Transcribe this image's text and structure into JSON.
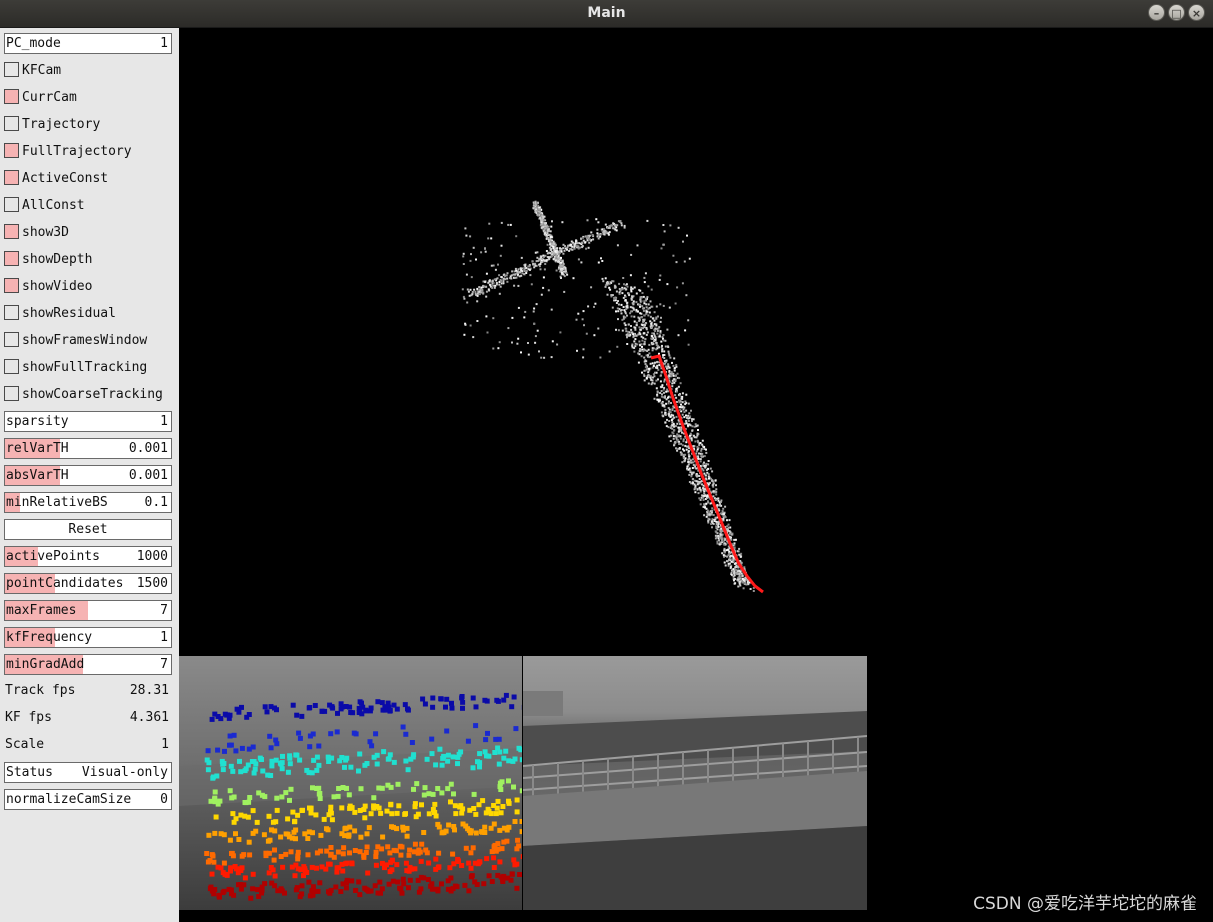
{
  "window": {
    "title": "Main"
  },
  "controls": {
    "pc_mode": {
      "label": "PC_mode",
      "value": "1"
    },
    "checkboxes": [
      {
        "label": "KFCam",
        "checked": false
      },
      {
        "label": "CurrCam",
        "checked": true
      },
      {
        "label": "Trajectory",
        "checked": false
      },
      {
        "label": "FullTrajectory",
        "checked": true
      },
      {
        "label": "ActiveConst",
        "checked": true
      },
      {
        "label": "AllConst",
        "checked": false
      },
      {
        "label": "show3D",
        "checked": true
      },
      {
        "label": "showDepth",
        "checked": true
      },
      {
        "label": "showVideo",
        "checked": true
      },
      {
        "label": "showResidual",
        "checked": false
      },
      {
        "label": "showFramesWindow",
        "checked": false
      },
      {
        "label": "showFullTracking",
        "checked": false
      },
      {
        "label": "showCoarseTracking",
        "checked": false
      }
    ],
    "sparsity": {
      "label": "sparsity",
      "value": "1",
      "level": 0
    },
    "relVarTH": {
      "label": "relVarTH",
      "value": "0.001",
      "level": 0.33
    },
    "absVarTH": {
      "label": "absVarTH",
      "value": "0.001",
      "level": 0.33
    },
    "minRelativeBS": {
      "label": "minRelativeBS",
      "value": "0.1",
      "level": 0.09
    },
    "reset": {
      "label": "Reset"
    },
    "activePoints": {
      "label": "activePoints",
      "value": "1000",
      "level": 0.2
    },
    "pointCandidates": {
      "label": "pointCandidates",
      "value": "1500",
      "level": 0.3
    },
    "maxFrames": {
      "label": "maxFrames",
      "value": "7",
      "level": 0.5
    },
    "kfFrequency": {
      "label": "kfFrequency",
      "value": "1",
      "level": 0.3
    },
    "minGradAdd": {
      "label": "minGradAdd",
      "value": "7",
      "level": 0.47
    },
    "track_fps": {
      "label": "Track fps",
      "value": "28.31"
    },
    "kf_fps": {
      "label": "KF fps",
      "value": "4.361"
    },
    "scale": {
      "label": "Scale",
      "value": "1"
    },
    "status": {
      "label": "Status",
      "value": "Visual-only"
    },
    "normalizeCamSize": {
      "label": "normalizeCamSize",
      "value": "0"
    }
  },
  "colors": {
    "panel_bg": "#e7e7e7",
    "slider_fill": "#f6b3b3",
    "trajectory": "#ff1a1a",
    "viewport_bg": "#000000"
  },
  "watermark": "CSDN @爱吃洋芋坨坨的麻雀"
}
